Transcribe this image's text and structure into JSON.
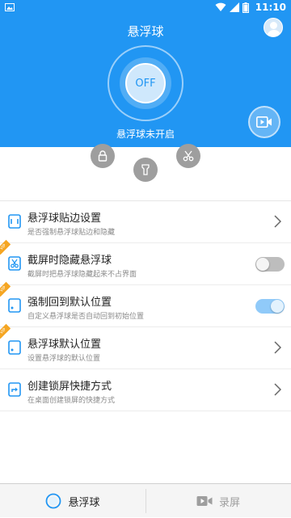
{
  "status_bar": {
    "time": "11:10"
  },
  "header": {
    "title": "悬浮球",
    "toggle_label": "OFF",
    "status_text": "悬浮球未开启"
  },
  "settings": [
    {
      "title": "悬浮球贴边设置",
      "desc": "是否强制悬浮球贴边和隐藏",
      "control": "chevron",
      "vip": false
    },
    {
      "title": "截屏时隐藏悬浮球",
      "desc": "截屏时把悬浮球隐藏起来不占界面",
      "control": "toggle",
      "toggle_on": false,
      "vip": true
    },
    {
      "title": "强制回到默认位置",
      "desc": "自定义悬浮球是否自动回到初始位置",
      "control": "toggle",
      "toggle_on": true,
      "vip": true
    },
    {
      "title": "悬浮球默认位置",
      "desc": "设置悬浮球的默认位置",
      "control": "chevron",
      "vip": true
    },
    {
      "title": "创建锁屏快捷方式",
      "desc": "在桌面创建锁屏的快捷方式",
      "control": "chevron",
      "vip": false
    }
  ],
  "vip_badge": "VIP",
  "tabs": [
    {
      "label": "悬浮球",
      "active": true
    },
    {
      "label": "录屏",
      "active": false
    }
  ],
  "colors": {
    "accent": "#2196F3",
    "toggle_on": "#90caf9",
    "toggle_off": "#bdbdbd",
    "inactive_text": "#9e9e9e"
  },
  "icons": [
    "image-icon",
    "wifi-icon",
    "signal-icon",
    "battery-icon",
    "avatar-icon",
    "video-camera-icon",
    "lock-icon",
    "flashlight-icon",
    "scissors-icon",
    "edge-icon",
    "screenshot-icon",
    "position-icon",
    "shortcut-icon",
    "chevron-right-icon"
  ]
}
